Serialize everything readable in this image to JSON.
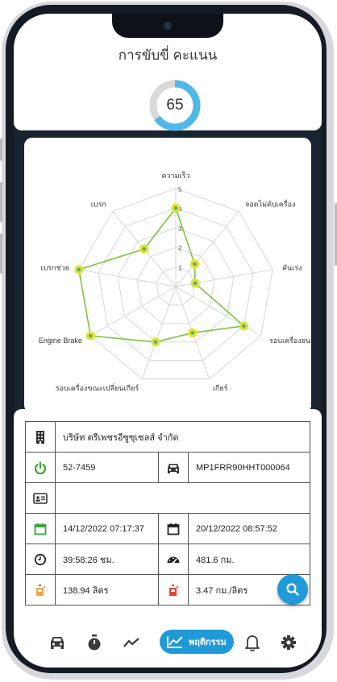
{
  "score": {
    "title": "การขับขี่ คะแนน",
    "value": "65",
    "percent": 65,
    "color_done": "#4fb8e8",
    "color_remaining": "#d9d9d9"
  },
  "chart_data": {
    "type": "radar",
    "categories": [
      "ความเร็ว",
      "จอดไม่ดับเครื่อง",
      "คันเร่ง",
      "รอบเครื่องยนต์",
      "เกียร์",
      "รอบเครื่องขณะเปลี่ยนเกียร์",
      "Engine Brake",
      "เบรกช่วย",
      "เบรก"
    ],
    "values": [
      4,
      1.5,
      1,
      4,
      2.5,
      3,
      5,
      5,
      2.5
    ],
    "ticks": [
      "1",
      "2",
      "3",
      "4",
      "5"
    ],
    "rlim": [
      0,
      5
    ],
    "line_color": "#7cc43f",
    "point_fill": "#e4e21a",
    "point_center": "#3aa6c6"
  },
  "info": {
    "company": "บริษัท ตรีเพชรอีซูซุเซลส์ จำกัด",
    "plate": "52-7459",
    "vin": "MP1FRR90HHT000064",
    "driver_card": "",
    "start_datetime": "14/12/2022 07:17:37",
    "end_datetime": "20/12/2022 08:57:52",
    "duration": "39:58:26 ชม.",
    "distance": "481.6 กม.",
    "fuel_used": "138.94 ลิตร",
    "fuel_rate": "3.47 กม./ลิตร"
  },
  "nav": {
    "items": [
      "car-icon",
      "stopwatch-icon",
      "trend-icon",
      "behavior-icon",
      "bell-icon",
      "gear-icon"
    ],
    "active_label": "พฤติกรรม",
    "accent": "#1f9ad7"
  }
}
